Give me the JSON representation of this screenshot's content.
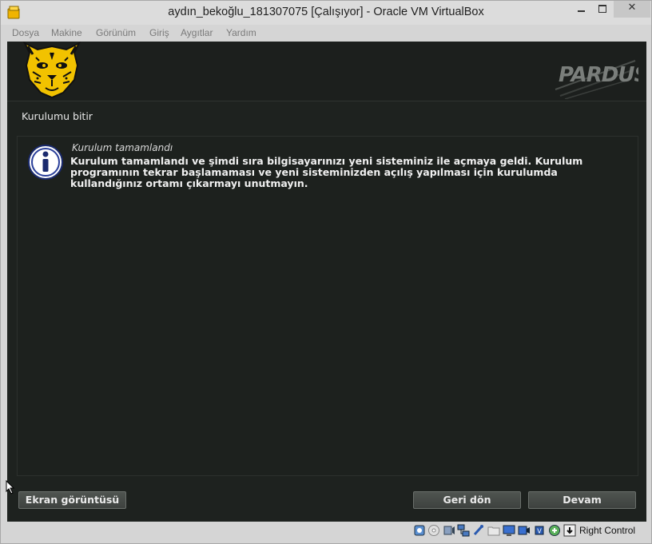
{
  "window": {
    "title": "aydın_bekoğlu_181307075 [Çalışıyor] - Oracle VM VirtualBox",
    "close_glyph": "✕"
  },
  "menu": {
    "items": [
      "Dosya",
      "Makine",
      "Görünüm",
      "Giriş",
      "Aygıtlar",
      "Yardım"
    ]
  },
  "installer": {
    "section_title": "Kurulumu bitir",
    "message_title": "Kurulum tamamlandı",
    "message_body": "Kurulum tamamlandı ve şimdi sıra bilgisayarınızı yeni sisteminiz ile açmaya geldi. Kurulum programının tekrar başlamaması ve yeni sisteminizden açılış yapılması için kurulumda kullandığınız ortamı çıkarmayı unutmayın.",
    "buttons": {
      "screenshot": "Ekran görüntüsü",
      "back": "Geri dön",
      "next": "Devam"
    },
    "logo_text": "PARDUS"
  },
  "statusbar": {
    "host_key": "Right Control",
    "icons": [
      "hard-disk-icon",
      "optical-drive-icon",
      "audio-icon",
      "network-icon",
      "usb-icon",
      "shared-folders-icon",
      "display-icon",
      "video-capture-icon",
      "cpu-icon",
      "mouse-integration-icon",
      "keyboard-icon"
    ]
  },
  "colors": {
    "vm_background": "#1e221f",
    "accent_yellow": "#f2c200",
    "text_light": "#f0f0f0"
  }
}
